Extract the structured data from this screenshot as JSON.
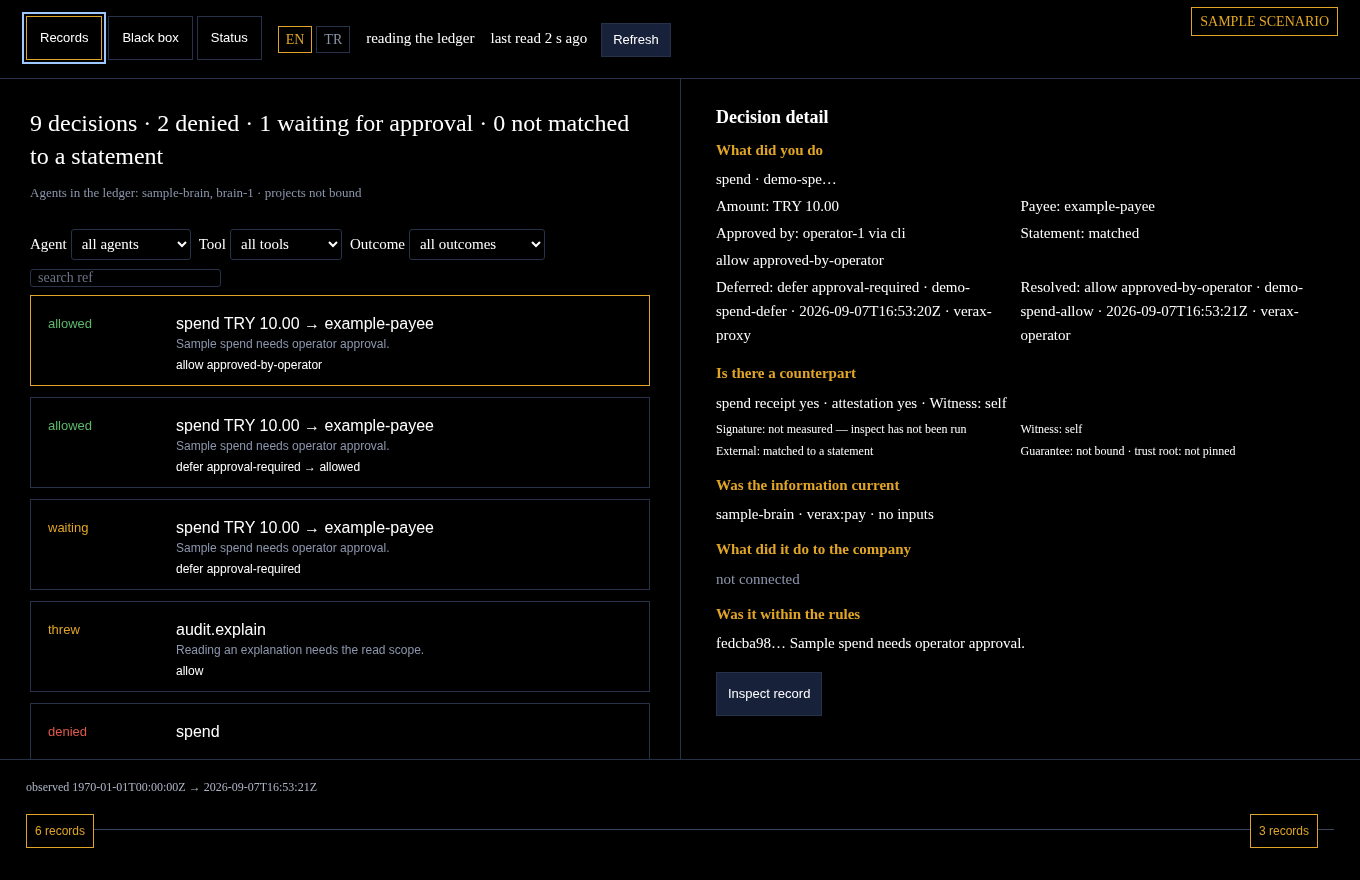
{
  "header": {
    "tabs": [
      {
        "label": "Records",
        "selected": true
      },
      {
        "label": "Black box",
        "selected": false
      },
      {
        "label": "Status",
        "selected": false
      }
    ],
    "languages": [
      {
        "label": "EN",
        "selected": true
      },
      {
        "label": "TR",
        "selected": false
      }
    ],
    "status_texts": [
      "reading the ledger",
      "last read 2 s ago"
    ],
    "refresh_button": "Refresh",
    "scenario_badge": "SAMPLE SCENARIO"
  },
  "summary": {
    "title": "9 decisions · 2 denied · 1 waiting for approval · 0 not matched to a statement",
    "subtitle": "Agents in the ledger: sample-brain, brain-1 · projects not bound"
  },
  "filters": [
    {
      "label": "Agent",
      "value": "all agents"
    },
    {
      "label": "Tool",
      "value": "all tools"
    },
    {
      "label": "Outcome",
      "value": "all outcomes"
    }
  ],
  "search": {
    "placeholder": "search ref"
  },
  "records": [
    {
      "outcome": "allowed",
      "title": "spend TRY 10.00 → example-payee",
      "reason": "Sample spend needs operator approval.",
      "decision": "allow approved-by-operator",
      "selected": true
    },
    {
      "outcome": "allowed",
      "title": "spend TRY 10.00 → example-payee",
      "reason": "Sample spend needs operator approval.",
      "decision": "defer approval-required → allowed",
      "selected": false
    },
    {
      "outcome": "waiting",
      "title": "spend TRY 10.00 → example-payee",
      "reason": "Sample spend needs operator approval.",
      "decision": "defer approval-required",
      "selected": false
    },
    {
      "outcome": "threw",
      "title": "audit.explain",
      "reason": "Reading an explanation needs the read scope.",
      "decision": "allow",
      "selected": false
    },
    {
      "outcome": "denied",
      "title": "spend",
      "selected": false
    }
  ],
  "detail": {
    "title": "Decision detail",
    "sections": [
      {
        "heading": "What did you do",
        "lines": [
          {
            "kind": "text",
            "texts": [
              "spend · demo-spe…"
            ]
          },
          {
            "kind": "pair",
            "texts": [
              "Amount: TRY 10.00",
              "Payee: example-payee"
            ]
          },
          {
            "kind": "pair",
            "texts": [
              "Approved by: operator-1 via cli",
              "Statement: matched"
            ]
          },
          {
            "kind": "text",
            "texts": [
              "allow approved-by-operator"
            ]
          },
          {
            "kind": "pair",
            "texts": [
              "Deferred: defer approval-required · demo-spend-defer · 2026-09-07T16:53:20Z · verax-proxy",
              "Resolved: allow approved-by-operator · demo-spend-allow · 2026-09-07T16:53:21Z · verax-operator"
            ]
          }
        ]
      },
      {
        "heading": "Is there a counterpart",
        "lines": [
          {
            "kind": "text",
            "texts": [
              "spend receipt yes · attestation yes · Witness: self"
            ]
          },
          {
            "kind": "small",
            "texts": [
              "Signature: not measured — inspect has not been run",
              "Witness: self"
            ]
          },
          {
            "kind": "small",
            "texts": [
              "External: matched to a statement",
              "Guarantee: not bound · trust root: not pinned"
            ]
          }
        ]
      },
      {
        "heading": "Was the information current",
        "lines": [
          {
            "kind": "text",
            "texts": [
              "sample-brain · verax:pay · no inputs"
            ]
          }
        ]
      },
      {
        "heading": "What did it do to the company",
        "lines": [
          {
            "kind": "muted",
            "texts": [
              "not connected"
            ]
          }
        ]
      },
      {
        "heading": "Was it within the rules",
        "lines": [
          {
            "kind": "text",
            "texts": [
              "fedcba98… Sample spend needs operator approval."
            ]
          }
        ]
      }
    ],
    "button": "Inspect record"
  },
  "footer": {
    "observed": "observed 1970-01-01T00:00:00Z → 2026-09-07T16:53:21Z",
    "timeline": {
      "start_label": "6 records",
      "end_label": "3 records"
    }
  }
}
